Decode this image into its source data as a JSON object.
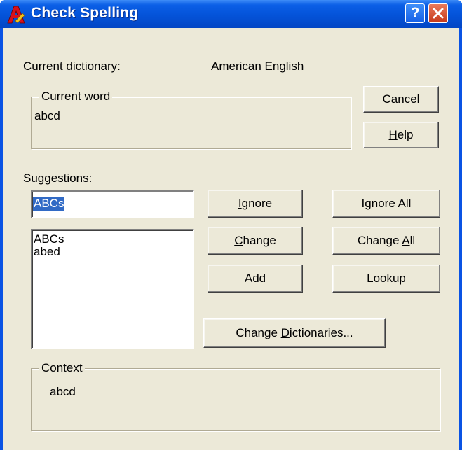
{
  "window": {
    "title": "Check Spelling",
    "help_button": "?",
    "colors": {
      "title_bar": "#0453d9",
      "dialog_bg": "#ece9d8",
      "selection": "#316ac5"
    }
  },
  "dictionary": {
    "label": "Current dictionary:",
    "value": "American English"
  },
  "current_word": {
    "label": "Current word",
    "value": "abcd"
  },
  "suggestions": {
    "label": "Suggestions:",
    "input_value": "ABCs",
    "items": [
      "ABCs",
      "abed"
    ]
  },
  "buttons": {
    "cancel": "Cancel",
    "help": {
      "pre": "",
      "mnemonic": "H",
      "post": "elp"
    },
    "ignore": {
      "pre": "",
      "mnemonic": "I",
      "post": "gnore"
    },
    "ignore_all": {
      "pre": "I",
      "mnemonic": "g",
      "post": "nore All"
    },
    "change": {
      "pre": "",
      "mnemonic": "C",
      "post": "hange"
    },
    "change_all": {
      "pre": "Change ",
      "mnemonic": "A",
      "post": "ll"
    },
    "add": {
      "pre": "",
      "mnemonic": "A",
      "post": "dd"
    },
    "lookup": {
      "pre": "",
      "mnemonic": "L",
      "post": "ookup"
    },
    "change_dictionaries": {
      "pre": "Change ",
      "mnemonic": "D",
      "post": "ictionaries..."
    }
  },
  "context": {
    "label": "Context",
    "value": "abcd"
  },
  "icons": [
    "autocad-app-icon",
    "help-icon",
    "close-icon"
  ]
}
